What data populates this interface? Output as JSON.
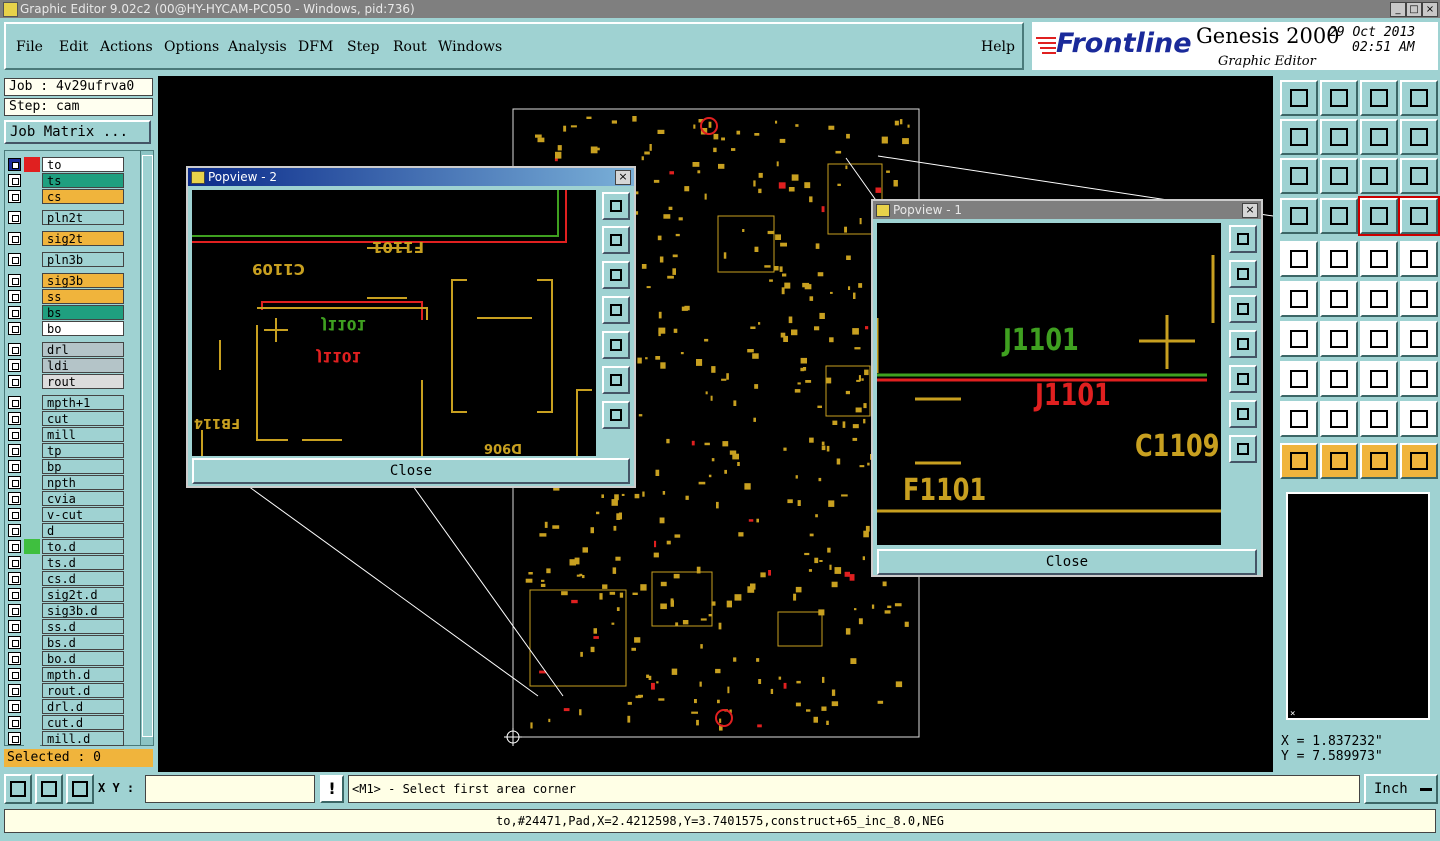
{
  "window": {
    "title": "Graphic Editor 9.02c2 (00@HY-HYCAM-PC050 - Windows, pid:736)"
  },
  "menu": {
    "items": [
      "File",
      "Edit",
      "Actions",
      "Options",
      "Analysis",
      "DFM",
      "Step",
      "Rout",
      "Windows"
    ],
    "help": "Help"
  },
  "branding": {
    "logo": "Frontline",
    "product": "Genesis 2000",
    "subtitle": "Graphic Editor",
    "date": "29 Oct 2013",
    "time": "02:51 AM"
  },
  "job": {
    "job_label": "Job : 4v29ufrva0",
    "step_label": "Step: cam",
    "matrix_button": "Job Matrix ...",
    "selected": "Selected : 0"
  },
  "layers": [
    {
      "name": "to",
      "color": "#e02020",
      "bg": "#ffffff",
      "active": true
    },
    {
      "name": "ts",
      "color": "#000000",
      "bg": "#1f9f7f",
      "active": false
    },
    {
      "name": "cs",
      "color": "#000000",
      "bg": "#f0b43c",
      "active": false
    },
    {
      "name": "pln2t",
      "color": "#000000",
      "bg": "#9fd2d2",
      "active": false
    },
    {
      "name": "sig2t",
      "color": "#000000",
      "bg": "#f0b43c",
      "active": false
    },
    {
      "name": "pln3b",
      "color": "#000000",
      "bg": "#9fd2d2",
      "active": false
    },
    {
      "name": "sig3b",
      "color": "#000000",
      "bg": "#f0b43c",
      "active": false
    },
    {
      "name": "ss",
      "color": "#000000",
      "bg": "#f0b43c",
      "active": false
    },
    {
      "name": "bs",
      "color": "#000000",
      "bg": "#1f9f7f",
      "active": false
    },
    {
      "name": "bo",
      "color": "#000000",
      "bg": "#ffffff",
      "active": false
    },
    {
      "name": "drl",
      "color": "#000000",
      "bg": "#b4c4c8",
      "active": false
    },
    {
      "name": "ldi",
      "color": "#000000",
      "bg": "#b4c4c8",
      "active": false
    },
    {
      "name": "rout",
      "color": "#000000",
      "bg": "#dcdcdc",
      "active": false
    },
    {
      "name": "mpth+1",
      "color": "#000000",
      "bg": "#9fd2d2",
      "active": false
    },
    {
      "name": "cut",
      "color": "#000000",
      "bg": "#9fd2d2",
      "active": false
    },
    {
      "name": "mill",
      "color": "#000000",
      "bg": "#9fd2d2",
      "active": false
    },
    {
      "name": "tp",
      "color": "#000000",
      "bg": "#9fd2d2",
      "active": false
    },
    {
      "name": "bp",
      "color": "#000000",
      "bg": "#9fd2d2",
      "active": false
    },
    {
      "name": "npth",
      "color": "#000000",
      "bg": "#9fd2d2",
      "active": false
    },
    {
      "name": "cvia",
      "color": "#000000",
      "bg": "#9fd2d2",
      "active": false
    },
    {
      "name": "v-cut",
      "color": "#000000",
      "bg": "#9fd2d2",
      "active": false
    },
    {
      "name": "d",
      "color": "#000000",
      "bg": "#9fd2d2",
      "active": false
    },
    {
      "name": "to.d",
      "color": "#3fbf3f",
      "bg": "#9fd2d2",
      "active": false
    },
    {
      "name": "ts.d",
      "color": "#000000",
      "bg": "#9fd2d2",
      "active": false
    },
    {
      "name": "cs.d",
      "color": "#000000",
      "bg": "#9fd2d2",
      "active": false
    },
    {
      "name": "sig2t.d",
      "color": "#000000",
      "bg": "#9fd2d2",
      "active": false
    },
    {
      "name": "sig3b.d",
      "color": "#000000",
      "bg": "#9fd2d2",
      "active": false
    },
    {
      "name": "ss.d",
      "color": "#000000",
      "bg": "#9fd2d2",
      "active": false
    },
    {
      "name": "bs.d",
      "color": "#000000",
      "bg": "#9fd2d2",
      "active": false
    },
    {
      "name": "bo.d",
      "color": "#000000",
      "bg": "#9fd2d2",
      "active": false
    },
    {
      "name": "mpth.d",
      "color": "#000000",
      "bg": "#9fd2d2",
      "active": false
    },
    {
      "name": "rout.d",
      "color": "#000000",
      "bg": "#9fd2d2",
      "active": false
    },
    {
      "name": "drl.d",
      "color": "#000000",
      "bg": "#9fd2d2",
      "active": false
    },
    {
      "name": "cut.d",
      "color": "#000000",
      "bg": "#9fd2d2",
      "active": false
    },
    {
      "name": "mill.d",
      "color": "#000000",
      "bg": "#9fd2d2",
      "active": false
    }
  ],
  "popview2": {
    "title": "Popview - 2",
    "close": "Close",
    "labels": [
      "F1101",
      "C1109",
      "J1101",
      "J1101",
      "FB114",
      "D906"
    ]
  },
  "popview1": {
    "title": "Popview - 1",
    "close": "Close",
    "labels": [
      "J1101",
      "J1101",
      "C1109",
      "F1101"
    ]
  },
  "coords": {
    "x": "X = 1.837232\"",
    "y": "Y = 7.589973\""
  },
  "bottom": {
    "xy_label": "X Y :",
    "xy_value": "",
    "prompt": "<M1> - Select first area corner",
    "units": "Inch",
    "status": "to,#24471,Pad,X=2.4212598,Y=3.7401575,construct+65_inc_8.0,NEG"
  },
  "colors": {
    "panel": "#9fd2d2",
    "pcb_yellow": "#c8a020",
    "pcb_red": "#e02020",
    "pcb_green": "#3fa020"
  }
}
